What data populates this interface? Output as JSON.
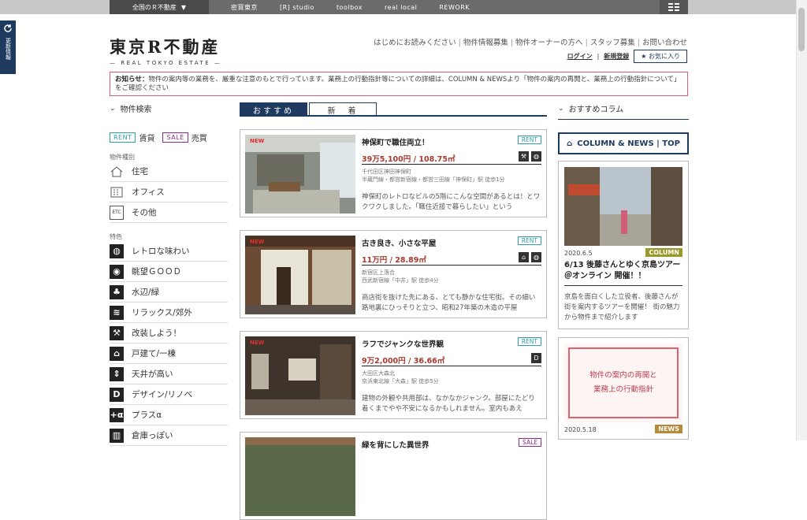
{
  "topnav": {
    "first": "全国のＲ不動産",
    "items": [
      "密買東京",
      "[R] studio",
      "toolbox",
      "real local",
      "REWORK"
    ]
  },
  "side_tab": {
    "label": "更新情報"
  },
  "logo": {
    "ja": "東京R不動産",
    "en": "— REAL TOKYO ESTATE —"
  },
  "header_links": [
    "はじめにお読みください",
    "物件情報募集",
    "物件オーナーの方へ",
    "スタッフ募集",
    "お問い合わせ"
  ],
  "account": {
    "login": "ログイン",
    "register": "新規登録",
    "favorites": "お気に入り"
  },
  "notice": {
    "prefix": "お知らせ：",
    "text": "物件の案内等の業務を、厳重な注意のもとで行っています。業務上の行動指針等についての詳細は、COLUMN & NEWSより「物件の案内の再開と、業務上の行動指針について」をご確認ください"
  },
  "search": {
    "title": "物件検索",
    "rent_badge": "RENT",
    "rent_label": "賃貸",
    "sale_badge": "SALE",
    "sale_label": "売買",
    "type_head": "物件種別",
    "types": [
      "住宅",
      "オフィス",
      "その他"
    ],
    "feature_head": "特色",
    "features": [
      "レトロな味わい",
      "眺望ＧＯＯＤ",
      "水辺/緑",
      "リラックス/郊外",
      "改装しよう！",
      "戸建て/一棟",
      "天井が高い",
      "デザイン/リノベ",
      "プラスα",
      "倉庫っぽい"
    ]
  },
  "tabs": {
    "recommended": "おすすめ",
    "new": "新　着"
  },
  "listings": [
    {
      "new_label": "NEW",
      "title": "神保町で職住両立！",
      "kind": "RENT",
      "price": "39万5,100円 / 108.75㎡",
      "address": "千代田区神田神保町",
      "station": "半蔵門線・都営新宿線・都営三田線「神保町」駅 徒歩1分",
      "desc": "神保町のレトロなビルの5階にこんな空間があるとは！とワクワクしました。「職住近接で暮らしたい」という"
    },
    {
      "new_label": "NEW",
      "title": "古き良き、小さな平屋",
      "kind": "RENT",
      "price": "11万円 / 28.89㎡",
      "address": "新宿区上落合",
      "station": "西武新宿線「中井」駅 徒歩4分",
      "desc": "商店街を抜けた先にある、とても静かな住宅街。その細い路地裏にひっそりと立つ、昭和27年築の木造の平屋"
    },
    {
      "new_label": "NEW",
      "title": "ラフでジャンクな世界観",
      "kind": "RENT",
      "price": "9万2,000円 / 36.66㎡",
      "address": "大田区大森北",
      "station": "京浜東北線「大森」駅 徒歩5分",
      "desc": "建物の外観や共用部は、なかなかジャンク。部屋にたどり着くまでやや不安になるかもしれません。室内もあえ"
    },
    {
      "title": "緑を背にした異世界",
      "kind": "SALE"
    }
  ],
  "column": {
    "title": "おすすめコラム",
    "button": "COLUMN & NEWS | TOP",
    "cards": [
      {
        "date": "2020.6.5",
        "tag": "COLUMN",
        "title": "6/13 後藤さんとゆく京島ツアー＠オンライン 開催！！",
        "text": "京島を面白くした立役者、後藤さんが街を案内するツアーを開催！ 街の魅力から物件まで紹介します"
      },
      {
        "date": "2020.5.18",
        "tag": "NEWS",
        "image_text": [
          "物件の案内の再開と",
          "業務上の行動指針"
        ]
      }
    ]
  }
}
